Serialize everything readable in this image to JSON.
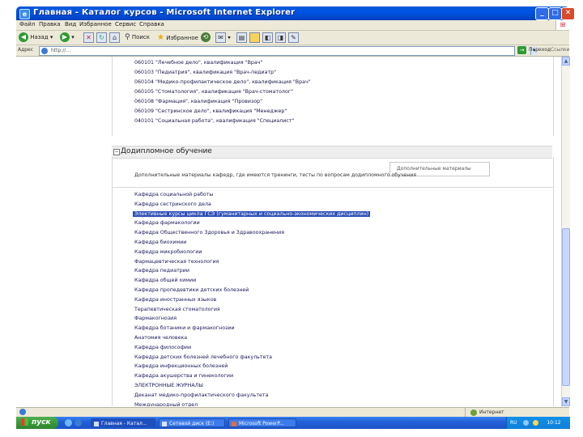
{
  "window": {
    "title": "Главная - Каталог курсов - Microsoft Internet Explorer"
  },
  "menu": [
    "Файл",
    "Правка",
    "Вид",
    "Избранное",
    "Сервис",
    "Справка"
  ],
  "toolbar": {
    "back_label": "Назад",
    "search_label": "Поиск",
    "favorites_label": "Избранное"
  },
  "address": {
    "label": "Адрес",
    "url": "http://...",
    "go_label": "Переход",
    "links_label": "Ссылки"
  },
  "specialties": [
    "060101 \"Лечебное дело\", квалификация \"Врач\"",
    "060103 \"Педиатрия\", квалификация \"Врач-педиатр\"",
    "060104 \"Медико-профилактическое дело\", квалификация \"Врач\"",
    "060105 \"Стоматология\", квалификация \"Врач-стоматолог\"",
    "060108 \"Фармация\", квалификация \"Провизор\"",
    "060109 \"Сестринское дело\", квалификация \"Менеджер\"",
    "040101 \"Социальная работа\", квалификация \"Специалист\""
  ],
  "section": {
    "title": "Додипломное обучение",
    "dropdown_label": "Дополнительные материалы",
    "intro": "Дополнительные материалы кафедр, где имеются тренинги, тесты по вопросам додипломного обучения"
  },
  "departments": [
    "Кафедра социальной работы",
    "Кафедра сестринского дела",
    "Элективные курсы цикла ГСЭ (гуманитарных и социально-экономических дисциплин)",
    "Кафедра фармакологии",
    "Кафедра Общественного Здоровья и Здравоохранения",
    "Кафедра биохимии",
    "Кафедра микробиологии",
    "Фармацевтическая технология",
    "Кафедра педиатрии",
    "Кафедра общей химии",
    "Кафедра пропедевтики детских болезней",
    "Кафедра иностранных языков",
    "Терапевтическая стоматология",
    "Фармакогнозия",
    "Кафедра ботаники и фармакогнозии",
    "Анатомия человека",
    "Кафедра философии",
    "Кафедра детских болезней лечебного факультета",
    "Кафедра инфекционных болезней",
    "Кафедра акушерства и гинекологии",
    "ЭЛЕКТРОННЫЕ ЖУРНАЛЫ",
    "Деканат медико-профилактического факультета",
    "Международный отдел"
  ],
  "selected_department_index": 2,
  "statusbar": {
    "zone": "Интернет"
  },
  "taskbar": {
    "start_label": "пуск",
    "tasks": [
      "Главная - Катал...",
      "Сетевой диск (E:)",
      "Microsoft PowerP..."
    ],
    "tray_text": "RU",
    "clock": "10:12"
  }
}
